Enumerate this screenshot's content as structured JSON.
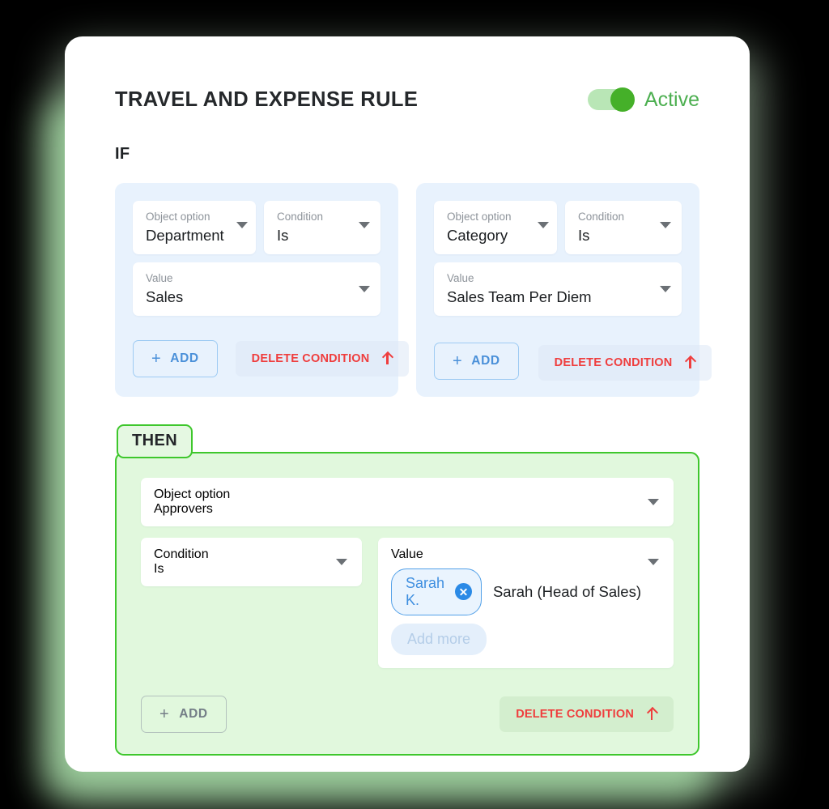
{
  "header": {
    "title": "TRAVEL AND EXPENSE RULE",
    "toggle_state": "on",
    "toggle_label": "Active",
    "accent_green": "#45b029",
    "accent_blue": "#4a90d9",
    "accent_red": "#ef3d3d"
  },
  "if_section": {
    "label": "IF",
    "conditions": [
      {
        "object_option": {
          "label": "Object option",
          "value": "Department"
        },
        "condition": {
          "label": "Condition",
          "value": "Is"
        },
        "value": {
          "label": "Value",
          "value": "Sales"
        },
        "add_label": "ADD",
        "delete_label": "DELETE CONDITION"
      },
      {
        "object_option": {
          "label": "Object option",
          "value": "Category"
        },
        "condition": {
          "label": "Condition",
          "value": "Is"
        },
        "value": {
          "label": "Value",
          "value": "Sales Team Per Diem"
        },
        "add_label": "ADD",
        "delete_label": "DELETE CONDITION"
      }
    ]
  },
  "then_section": {
    "label": "THEN",
    "object_option": {
      "label": "Object option",
      "value": "Approvers"
    },
    "condition": {
      "label": "Condition",
      "value": "Is"
    },
    "value": {
      "label": "Value",
      "chips": [
        {
          "name": "Sarah K.",
          "remove_icon": "close-circle-icon"
        }
      ],
      "chip_description": "Sarah (Head of Sales)",
      "add_more_label": "Add more"
    },
    "add_label": "ADD",
    "delete_label": "DELETE CONDITION"
  },
  "icons": {
    "plus": "+",
    "caret": "chevron-down-icon",
    "arrow": "arrow-up-icon"
  }
}
